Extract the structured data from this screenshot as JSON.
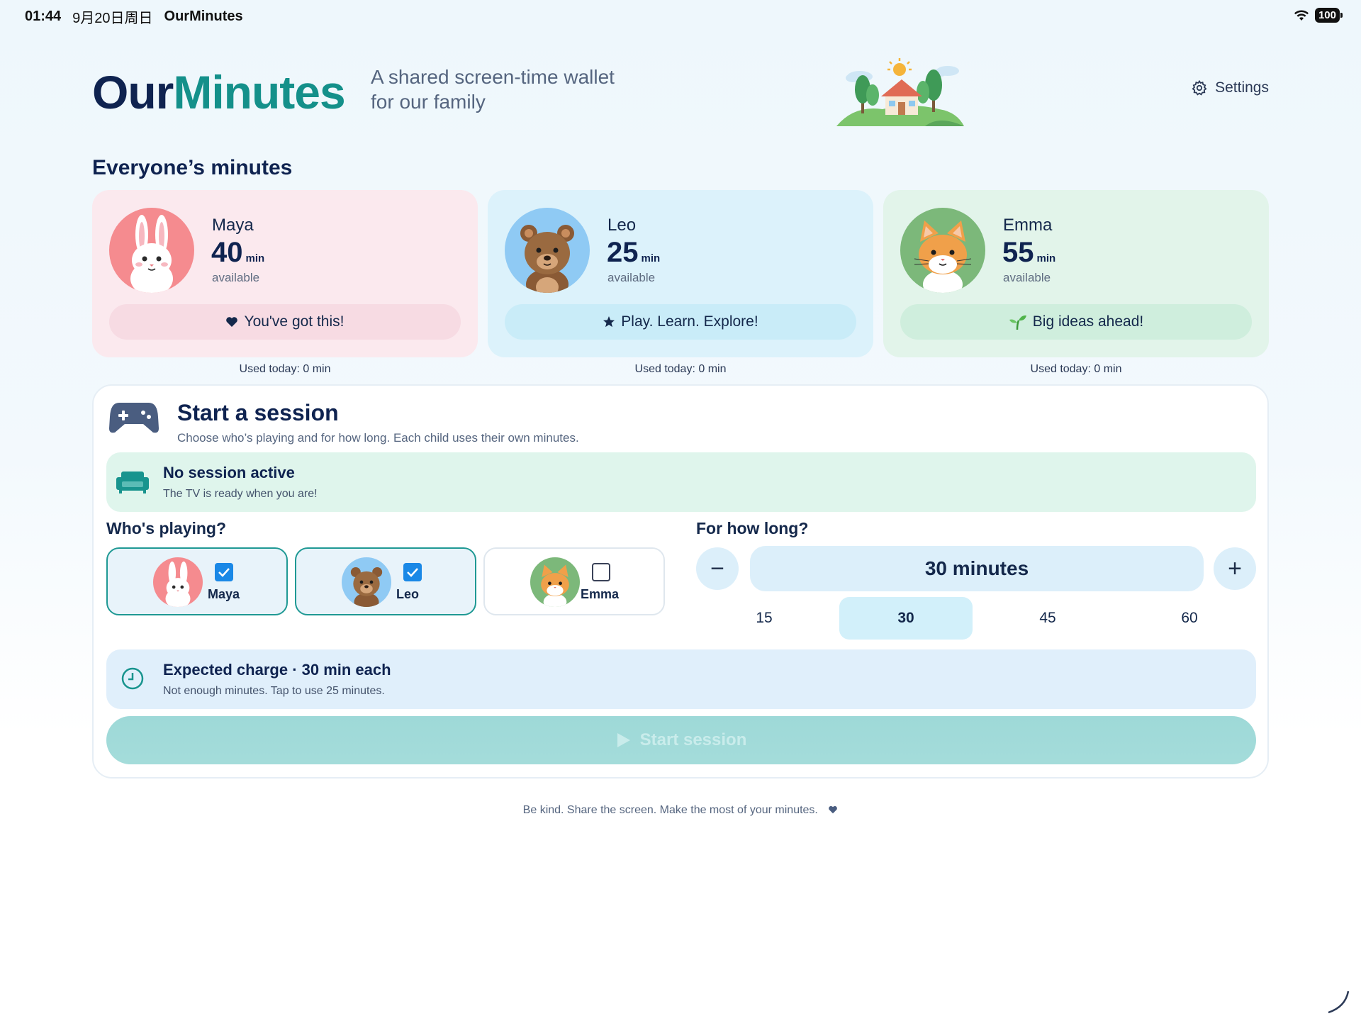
{
  "status_bar": {
    "time": "01:44",
    "date": "9月20日周日",
    "app": "OurMinutes",
    "battery": "100"
  },
  "header": {
    "logo_part1": "Our",
    "logo_part2": "Minutes",
    "tagline_line1": "A shared screen-time wallet",
    "tagline_line2": "for our family",
    "settings_label": "Settings"
  },
  "section_title": "Everyone’s minutes",
  "kids": [
    {
      "name": "Maya",
      "minutes": "40",
      "unit": "min",
      "available": "available",
      "motto": "You've got this!",
      "motto_icon": "heart-icon",
      "used": "Used today: 0 min",
      "color": "#f58b8f"
    },
    {
      "name": "Leo",
      "minutes": "25",
      "unit": "min",
      "available": "available",
      "motto": "Play. Learn. Explore!",
      "motto_icon": "star-icon",
      "used": "Used today: 0 min",
      "color": "#8fcaf4"
    },
    {
      "name": "Emma",
      "minutes": "55",
      "unit": "min",
      "available": "available",
      "motto": "Big ideas ahead!",
      "motto_icon": "sprout-icon",
      "used": "Used today: 0 min",
      "color": "#7cb87a"
    }
  ],
  "session": {
    "title": "Start a session",
    "subtitle": "Choose who’s playing and for how long. Each child uses their own minutes.",
    "status_title": "No session active",
    "status_sub": "The TV is ready when you are!",
    "who_label": "Who's playing?",
    "players": [
      {
        "name": "Maya",
        "selected": true
      },
      {
        "name": "Leo",
        "selected": true
      },
      {
        "name": "Emma",
        "selected": false
      }
    ],
    "how_long_label": "For how long?",
    "duration_display": "30 minutes",
    "minus": "−",
    "plus": "+",
    "presets": [
      "15",
      "30",
      "45",
      "60"
    ],
    "selected_preset": "30",
    "charge_title": "Expected charge · 30 min each",
    "charge_sub": "Not enough minutes. Tap to use 25 minutes.",
    "start_label": "Start session",
    "start_enabled": false
  },
  "footer": "Be kind. Share the screen. Make the most of your minutes.",
  "colors": {
    "navy": "#0f2350",
    "teal": "#14908a",
    "select_blue": "#1a88e6"
  }
}
